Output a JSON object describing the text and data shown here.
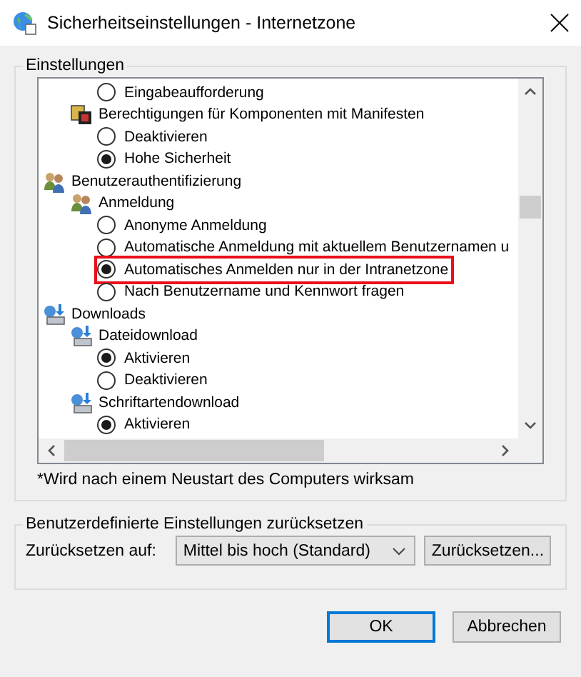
{
  "window": {
    "title": "Sicherheitseinstellungen - Internetzone"
  },
  "settings_group": {
    "title": "Einstellungen",
    "settings": [
      {
        "kind": "continuation",
        "children": [
          {
            "kind": "continuation",
            "children": [
              {
                "kind": "option",
                "label": "Eingabeaufforderung",
                "selected": false,
                "highlighted": false
              }
            ]
          },
          {
            "kind": "component-group",
            "label": "Berechtigungen für Komponenten mit Manifesten",
            "children": [
              {
                "kind": "option",
                "label": "Deaktivieren",
                "selected": false,
                "highlighted": false
              },
              {
                "kind": "option",
                "label": "Hohe Sicherheit",
                "selected": true,
                "highlighted": false
              }
            ]
          }
        ]
      },
      {
        "kind": "users-group",
        "label": "Benutzerauthentifizierung",
        "children": [
          {
            "kind": "users-group",
            "label": "Anmeldung",
            "children": [
              {
                "kind": "option",
                "label": "Anonyme Anmeldung",
                "selected": false,
                "highlighted": false
              },
              {
                "kind": "option",
                "label": "Automatische Anmeldung mit aktuellem Benutzernamen u",
                "selected": false,
                "highlighted": false
              },
              {
                "kind": "option",
                "label": "Automatisches Anmelden nur in der Intranetzone",
                "selected": true,
                "highlighted": true
              },
              {
                "kind": "option",
                "label": "Nach Benutzername und Kennwort fragen",
                "selected": false,
                "highlighted": false
              }
            ]
          }
        ]
      },
      {
        "kind": "download-group",
        "label": "Downloads",
        "children": [
          {
            "kind": "download-group",
            "label": "Dateidownload",
            "children": [
              {
                "kind": "option",
                "label": "Aktivieren",
                "selected": true,
                "highlighted": false
              },
              {
                "kind": "option",
                "label": "Deaktivieren",
                "selected": false,
                "highlighted": false
              }
            ]
          },
          {
            "kind": "download-group",
            "label": "Schriftartendownload",
            "children": [
              {
                "kind": "option",
                "label": "Aktivieren",
                "selected": true,
                "highlighted": false
              }
            ]
          }
        ]
      }
    ],
    "note": "*Wird nach einem Neustart des Computers wirksam"
  },
  "reset_group": {
    "title": "Benutzerdefinierte Einstellungen zurücksetzen",
    "label": "Zurücksetzen auf:",
    "level_value": "Mittel bis hoch (Standard)",
    "reset_button": "Zurücksetzen..."
  },
  "buttons": [
    {
      "label": "OK",
      "default": true
    },
    {
      "label": "Abbrechen",
      "default": false
    }
  ]
}
